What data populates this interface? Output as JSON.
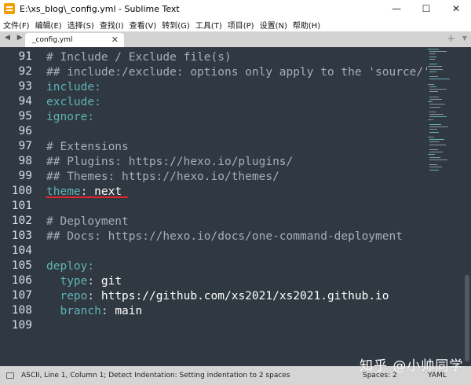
{
  "window": {
    "title": "E:\\xs_blog\\_config.yml - Sublime Text",
    "controls": {
      "minimize": "—",
      "maximize": "☐",
      "close": "✕"
    }
  },
  "menu": [
    "文件(F)",
    "编辑(E)",
    "选择(S)",
    "查找(I)",
    "查看(V)",
    "转到(G)",
    "工具(T)",
    "项目(P)",
    "设置(N)",
    "帮助(H)"
  ],
  "tabs": {
    "nav": "◀ ▶",
    "active": {
      "label": "_config.yml",
      "close": "✕"
    },
    "add": "+",
    "dropdown": "▼"
  },
  "editor": {
    "lines": [
      {
        "num": "91",
        "segments": [
          {
            "t": "# Include / Exclude file(s)",
            "c": "comment"
          }
        ]
      },
      {
        "num": "92",
        "segments": [
          {
            "t": "## include:/exclude: options only apply to the 'source/'",
            "c": "comment"
          }
        ]
      },
      {
        "num": "93",
        "segments": [
          {
            "t": "include:",
            "c": "key"
          }
        ]
      },
      {
        "num": "94",
        "segments": [
          {
            "t": "exclude:",
            "c": "key"
          }
        ]
      },
      {
        "num": "95",
        "segments": [
          {
            "t": "ignore:",
            "c": "key"
          }
        ]
      },
      {
        "num": "96",
        "segments": []
      },
      {
        "num": "97",
        "segments": [
          {
            "t": "# Extensions",
            "c": "comment"
          }
        ]
      },
      {
        "num": "98",
        "segments": [
          {
            "t": "## Plugins: https://hexo.io/plugins/",
            "c": "comment"
          }
        ]
      },
      {
        "num": "99",
        "segments": [
          {
            "t": "## Themes: https://hexo.io/themes/",
            "c": "comment"
          }
        ]
      },
      {
        "num": "100",
        "segments": [
          {
            "t": "theme",
            "c": "key"
          },
          {
            "t": ": ",
            "c": "plain"
          },
          {
            "t": "next",
            "c": "value"
          }
        ]
      },
      {
        "num": "101",
        "segments": []
      },
      {
        "num": "102",
        "segments": [
          {
            "t": "# Deployment",
            "c": "comment"
          }
        ]
      },
      {
        "num": "103",
        "segments": [
          {
            "t": "## Docs: https://hexo.io/docs/one-command-deployment",
            "c": "comment"
          }
        ]
      },
      {
        "num": "104",
        "segments": []
      },
      {
        "num": "105",
        "segments": [
          {
            "t": "deploy:",
            "c": "key"
          }
        ]
      },
      {
        "num": "106",
        "segments": [
          {
            "t": "  type",
            "c": "key"
          },
          {
            "t": ": ",
            "c": "plain"
          },
          {
            "t": "git",
            "c": "value"
          }
        ]
      },
      {
        "num": "107",
        "segments": [
          {
            "t": "  repo",
            "c": "key"
          },
          {
            "t": ": ",
            "c": "plain"
          },
          {
            "t": "https://github.com/xs2021/xs2021.github.io",
            "c": "value"
          }
        ]
      },
      {
        "num": "108",
        "segments": [
          {
            "t": "  branch",
            "c": "key"
          },
          {
            "t": ": ",
            "c": "plain"
          },
          {
            "t": "main",
            "c": "value"
          }
        ]
      },
      {
        "num": "109",
        "segments": []
      }
    ]
  },
  "status": {
    "message": "ASCII, Line 1, Column 1; Detect Indentation: Setting indentation to 2 spaces",
    "spaces": "Spaces: 2",
    "syntax": "YAML"
  },
  "watermark": "知乎 @小帅同学",
  "colors": {
    "editor_bg": "#303841",
    "comment": "#a7adba",
    "key": "#5fb4b4",
    "value": "#ffffff",
    "annotation": "#e0242b"
  }
}
